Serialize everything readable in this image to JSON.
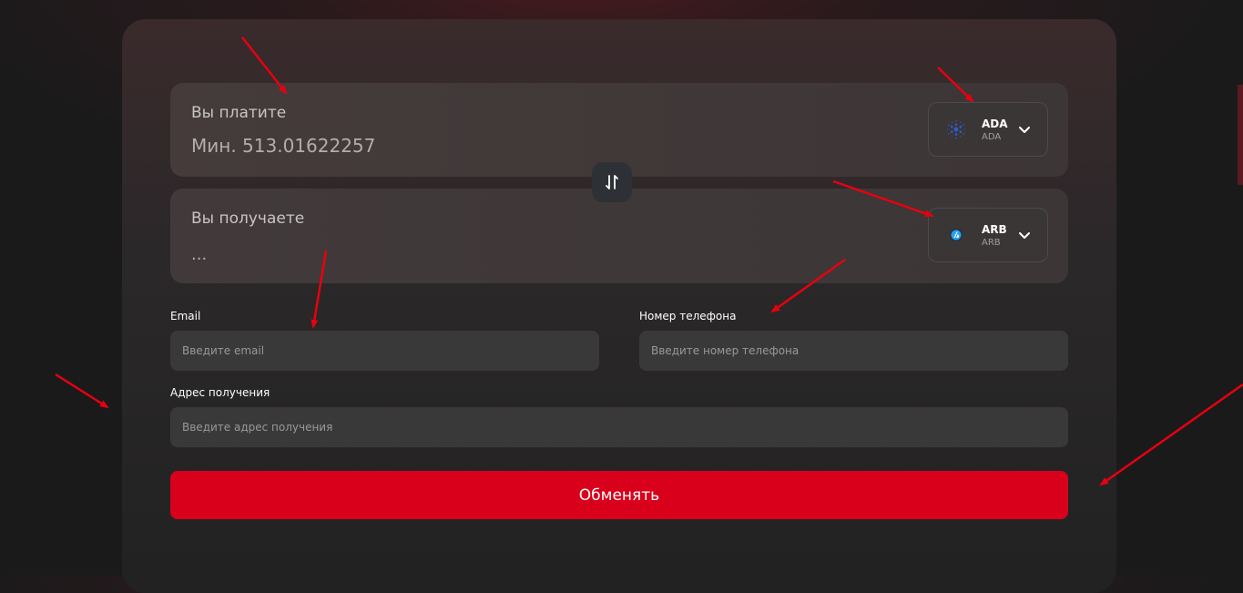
{
  "exchange": {
    "pay": {
      "label": "Вы платите",
      "amount_text": "Мин. 513.01622257",
      "coin": {
        "name": "ADA",
        "ticker": "ADA",
        "icon": "cardano-logo-icon",
        "color": "#2a5cd6"
      }
    },
    "receive": {
      "label": "Вы получаете",
      "amount_text": "...",
      "coin": {
        "name": "ARB",
        "ticker": "ARB",
        "icon": "arbitrum-logo-icon",
        "color": "#28a0f0"
      }
    },
    "swap_icon": "swap-arrows-icon"
  },
  "form": {
    "email": {
      "label": "Email",
      "placeholder": "Введите email"
    },
    "phone": {
      "label": "Номер телефона",
      "placeholder": "Введите номер телефона"
    },
    "address": {
      "label": "Адрес получения",
      "placeholder": "Введите адрес получения"
    },
    "submit_label": "Обменять"
  },
  "colors": {
    "accent": "#d9001b",
    "annotation_arrow": "#e8000f",
    "background": "#1b1a1b",
    "card": "#262425"
  }
}
